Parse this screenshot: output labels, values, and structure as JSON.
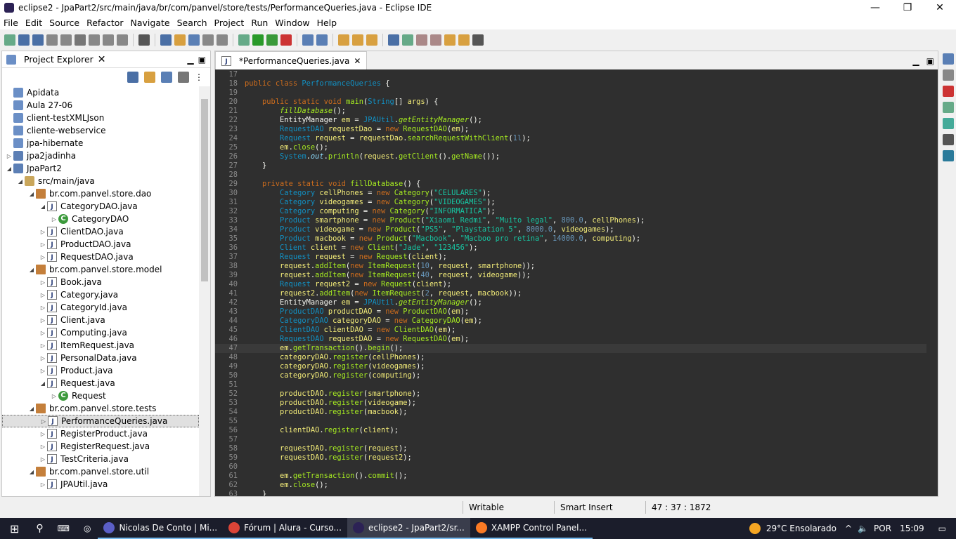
{
  "window": {
    "title": "eclipse2 - JpaPart2/src/main/java/br/com/panvel/store/tests/PerformanceQueries.java - Eclipse IDE",
    "minimize": "—",
    "maximize": "❐",
    "close": "✕"
  },
  "menu": [
    "File",
    "Edit",
    "Source",
    "Refactor",
    "Navigate",
    "Search",
    "Project",
    "Run",
    "Window",
    "Help"
  ],
  "explorer": {
    "title": "Project Explorer",
    "close": "✕",
    "items": [
      {
        "depth": 0,
        "tw": "",
        "icon": "folder",
        "label": "Apidata"
      },
      {
        "depth": 0,
        "tw": "",
        "icon": "folder",
        "label": "Aula 27-06"
      },
      {
        "depth": 0,
        "tw": "",
        "icon": "folder",
        "label": "client-testXMLJson"
      },
      {
        "depth": 0,
        "tw": "",
        "icon": "folder",
        "label": "cliente-webservice"
      },
      {
        "depth": 0,
        "tw": "",
        "icon": "folder",
        "label": "jpa-hibernate"
      },
      {
        "depth": 0,
        "tw": "▷",
        "icon": "proj",
        "label": "jpa2jadinha"
      },
      {
        "depth": 0,
        "tw": "◢",
        "icon": "proj",
        "label": "JpaPart2"
      },
      {
        "depth": 1,
        "tw": "◢",
        "icon": "src",
        "label": "src/main/java"
      },
      {
        "depth": 2,
        "tw": "◢",
        "icon": "pkg",
        "label": "br.com.panvel.store.dao"
      },
      {
        "depth": 3,
        "tw": "◢",
        "icon": "java",
        "label": "CategoryDAO.java"
      },
      {
        "depth": 4,
        "tw": "▷",
        "icon": "cls",
        "label": "CategoryDAO"
      },
      {
        "depth": 3,
        "tw": "▷",
        "icon": "java",
        "label": "ClientDAO.java"
      },
      {
        "depth": 3,
        "tw": "▷",
        "icon": "java",
        "label": "ProductDAO.java"
      },
      {
        "depth": 3,
        "tw": "▷",
        "icon": "java",
        "label": "RequestDAO.java"
      },
      {
        "depth": 2,
        "tw": "◢",
        "icon": "pkg",
        "label": "br.com.panvel.store.model"
      },
      {
        "depth": 3,
        "tw": "▷",
        "icon": "java",
        "label": "Book.java"
      },
      {
        "depth": 3,
        "tw": "▷",
        "icon": "java",
        "label": "Category.java"
      },
      {
        "depth": 3,
        "tw": "▷",
        "icon": "java",
        "label": "CategoryId.java"
      },
      {
        "depth": 3,
        "tw": "▷",
        "icon": "java",
        "label": "Client.java"
      },
      {
        "depth": 3,
        "tw": "▷",
        "icon": "java",
        "label": "Computing.java"
      },
      {
        "depth": 3,
        "tw": "▷",
        "icon": "java",
        "label": "ItemRequest.java"
      },
      {
        "depth": 3,
        "tw": "▷",
        "icon": "java",
        "label": "PersonalData.java"
      },
      {
        "depth": 3,
        "tw": "▷",
        "icon": "java",
        "label": "Product.java"
      },
      {
        "depth": 3,
        "tw": "◢",
        "icon": "java",
        "label": "Request.java"
      },
      {
        "depth": 4,
        "tw": "▷",
        "icon": "cls",
        "label": "Request"
      },
      {
        "depth": 2,
        "tw": "◢",
        "icon": "pkg",
        "label": "br.com.panvel.store.tests"
      },
      {
        "depth": 3,
        "tw": "▷",
        "icon": "java",
        "label": "PerformanceQueries.java",
        "selected": true
      },
      {
        "depth": 3,
        "tw": "▷",
        "icon": "java",
        "label": "RegisterProduct.java"
      },
      {
        "depth": 3,
        "tw": "▷",
        "icon": "java",
        "label": "RegisterRequest.java"
      },
      {
        "depth": 3,
        "tw": "▷",
        "icon": "java",
        "label": "TestCriteria.java"
      },
      {
        "depth": 2,
        "tw": "◢",
        "icon": "pkg",
        "label": "br.com.panvel.store.util"
      },
      {
        "depth": 3,
        "tw": "▷",
        "icon": "java",
        "label": "JPAUtil.java"
      }
    ]
  },
  "editor": {
    "tab": "*PerformanceQueries.java",
    "close": "✕",
    "first_line": 17,
    "current_line": 47,
    "lines": [
      "",
      "public class PerformanceQueries {",
      "",
      "    public static void main(String[] args) {",
      "        fillDatabase();",
      "        EntityManager em = JPAUtil.getEntityManager();",
      "        RequestDAO requestDao = new RequestDAO(em);",
      "        Request request = requestDao.searchRequestWithClient(1l);",
      "        em.close();",
      "        System.out.println(request.getClient().getName());",
      "    }",
      "",
      "    private static void fillDatabase() {",
      "        Category cellPhones = new Category(\"CELULARES\");",
      "        Category videogames = new Category(\"VIDEOGAMES\");",
      "        Category computing = new Category(\"INFORMATICA\");",
      "        Product smartphone = new Product(\"Xiaomi Redmi\", \"Muito legal\", 800.0, cellPhones);",
      "        Product videogame = new Product(\"PS5\", \"Playstation 5\", 8000.0, videogames);",
      "        Product macbook = new Product(\"Macbook\", \"Macboo pro retina\", 14000.0, computing);",
      "        Client client = new Client(\"Jade\", \"123456\");",
      "        Request request = new Request(client);",
      "        request.addItem(new ItemRequest(10, request, smartphone));",
      "        request.addItem(new ItemRequest(40, request, videogame));",
      "        Request request2 = new Request(client);",
      "        request2.addItem(new ItemRequest(2, request, macbook));",
      "        EntityManager em = JPAUtil.getEntityManager();",
      "        ProductDAO productDAO = new ProductDAO(em);",
      "        CategoryDAO categoryDAO = new CategoryDAO(em);",
      "        ClientDAO clientDAO = new ClientDAO(em);",
      "        RequestDAO requestDAO = new RequestDAO(em);",
      "        em.getTransaction().begin();",
      "        categoryDAO.register(cellPhones);",
      "        categoryDAO.register(videogames);",
      "        categoryDAO.register(computing);",
      "",
      "        productDAO.register(smartphone);",
      "        productDAO.register(videogame);",
      "        productDAO.register(macbook);",
      "",
      "        clientDAO.register(client);",
      "",
      "        requestDAO.register(request);",
      "        requestDAO.register(request2);",
      "",
      "        em.getTransaction().commit();",
      "        em.close();",
      "    }"
    ]
  },
  "status": {
    "mode": "Writable",
    "insert": "Smart Insert",
    "position": "47 : 37 : 1872"
  },
  "taskbar": {
    "apps": [
      {
        "label": "Nicolas De Conto | Mi...",
        "color": "#5b5fc7"
      },
      {
        "label": "Fórum | Alura - Curso...",
        "color": "#db4437"
      },
      {
        "label": "eclipse2 - JpaPart2/sr...",
        "color": "#2c2255",
        "active": true
      },
      {
        "label": "XAMPP Control Panel...",
        "color": "#fb7a24"
      }
    ],
    "weather": "29°C  Ensolarado",
    "lang": "POR",
    "time": "15:09"
  },
  "colors": {
    "editor_bg": "#2f2f2f",
    "keyword": "#cc6c1d",
    "type": "#1290c3",
    "string": "#17c6a3",
    "method": "#a7ec21",
    "variable": "#f3ec79"
  }
}
